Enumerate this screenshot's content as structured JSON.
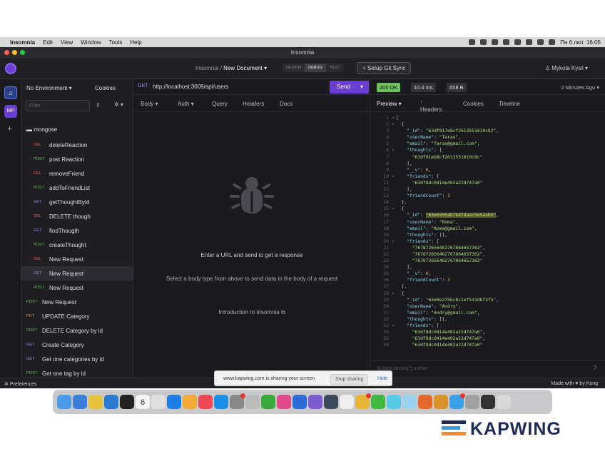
{
  "menubar": {
    "app": "Insomnia",
    "items": [
      "Edit",
      "View",
      "Window",
      "Tools",
      "Help"
    ],
    "clock": "Пн 6 лют.  16:05"
  },
  "window": {
    "title": "Insomnia"
  },
  "toolbar": {
    "breadcrumb_root": "Insomnia",
    "separator": "/",
    "document": "New Document ▾",
    "modes": [
      "DESIGN",
      "DEBUG",
      "TEST"
    ],
    "active_mode": "DEBUG",
    "git_button": "Setup Git Sync",
    "user": "Mykola Kysil ▾"
  },
  "rail": {
    "home_icon": "home-icon",
    "workspace": "MP",
    "add": "+"
  },
  "sidebar": {
    "environment": "No Environment ▾",
    "cookies": "Cookies",
    "filter_placeholder": "Filter",
    "folder": "mongose",
    "items": [
      {
        "method": "DEL",
        "name": "deleteReaction",
        "indent": true
      },
      {
        "method": "POST",
        "name": "post Reaction",
        "indent": true
      },
      {
        "method": "DEL",
        "name": "removeFriend",
        "indent": true
      },
      {
        "method": "POST",
        "name": "addToFriendList",
        "indent": true
      },
      {
        "method": "GET",
        "name": "getThoughtById",
        "indent": true
      },
      {
        "method": "DEL",
        "name": "DELETE though",
        "indent": true
      },
      {
        "method": "GET",
        "name": "findThougth",
        "indent": true
      },
      {
        "method": "POST",
        "name": "createThought",
        "indent": true
      },
      {
        "method": "DEL",
        "name": "New Request",
        "indent": true
      },
      {
        "method": "GET",
        "name": "New Request",
        "indent": true,
        "selected": true
      },
      {
        "method": "POST",
        "name": "New Request",
        "indent": true
      },
      {
        "method": "POST",
        "name": "New Request",
        "indent": false
      },
      {
        "method": "PUT",
        "name": "UPDATE Category",
        "indent": false
      },
      {
        "method": "POST",
        "name": "DELETE Category by id",
        "indent": false
      },
      {
        "method": "GET",
        "name": "Create Category",
        "indent": false
      },
      {
        "method": "GET",
        "name": "Get one categories by id",
        "indent": false
      },
      {
        "method": "POST",
        "name": "Get one tag by id",
        "indent": false
      }
    ]
  },
  "request": {
    "method": "GET",
    "url": "http://localhost:3009/api/users",
    "send": "Send",
    "tabs": [
      "Body ▾",
      "Auth ▾",
      "Query",
      "Headers",
      "Docs"
    ],
    "empty_title": "Enter a URL and send to get a response",
    "empty_hint": "Select a body type from above to send data in the body of a request",
    "intro_link": "Introduction to Insomnia"
  },
  "response": {
    "status": "200 OK",
    "time": "10.4 ms",
    "size": "658 B",
    "age": "2 Minutes Ago ▾",
    "tabs": [
      "Preview ▾",
      "Headers",
      "Cookies",
      "Timeline"
    ],
    "headers_count": "7",
    "filter": "$.store.books[*].author",
    "help": "?"
  },
  "json_lines": [
    {
      "n": "1",
      "a": "▾",
      "t": [
        [
          "p",
          "["
        ]
      ]
    },
    {
      "n": "2",
      "a": "▾",
      "t": [
        [
          "p",
          "  {"
        ]
      ]
    },
    {
      "n": "3",
      "a": "",
      "t": [
        [
          "k",
          "    \"_id\""
        ],
        [
          "p",
          ": "
        ],
        [
          "s",
          "\"63df917e8cf2613551610c82\""
        ],
        [
          "p",
          ","
        ]
      ]
    },
    {
      "n": "4",
      "a": "",
      "t": [
        [
          "k",
          "    \"userName\""
        ],
        [
          "p",
          ": "
        ],
        [
          "s",
          "\"Taras\""
        ],
        [
          "p",
          ","
        ]
      ]
    },
    {
      "n": "5",
      "a": "",
      "t": [
        [
          "k",
          "    \"email\""
        ],
        [
          "p",
          ": "
        ],
        [
          "s",
          "\"Taras@gmail.com\""
        ],
        [
          "p",
          ","
        ]
      ]
    },
    {
      "n": "6",
      "a": "▾",
      "t": [
        [
          "k",
          "    \"thoughts\""
        ],
        [
          "p",
          ": ["
        ]
      ]
    },
    {
      "n": "7",
      "a": "",
      "t": [
        [
          "s",
          "      \"63df91eb8cf2613551610c8c\""
        ]
      ]
    },
    {
      "n": "8",
      "a": "",
      "t": [
        [
          "p",
          "    ],"
        ]
      ]
    },
    {
      "n": "9",
      "a": "",
      "t": [
        [
          "k",
          "    \"__v\""
        ],
        [
          "p",
          ": "
        ],
        [
          "n",
          "0"
        ],
        [
          "p",
          ","
        ]
      ]
    },
    {
      "n": "10",
      "a": "▾",
      "t": [
        [
          "k",
          "    \"friends\""
        ],
        [
          "p",
          ": ["
        ]
      ]
    },
    {
      "n": "11",
      "a": "",
      "t": [
        [
          "s",
          "      \"63df8dc0414e402a22d747a0\""
        ]
      ]
    },
    {
      "n": "12",
      "a": "",
      "t": [
        [
          "p",
          "    ],"
        ]
      ]
    },
    {
      "n": "13",
      "a": "",
      "t": [
        [
          "k",
          "    \"friendCount\""
        ],
        [
          "p",
          ": "
        ],
        [
          "n",
          "1"
        ]
      ]
    },
    {
      "n": "14",
      "a": "",
      "t": [
        [
          "p",
          "  },"
        ]
      ]
    },
    {
      "n": "15",
      "a": "▾",
      "t": [
        [
          "p",
          "  {"
        ]
      ]
    },
    {
      "n": "16",
      "a": "",
      "t": [
        [
          "k",
          "    \"_id\""
        ],
        [
          "p",
          ": "
        ],
        [
          "hl",
          "\"63e0255ab7b4fdaac5e5aab5\""
        ],
        [
          "p",
          ","
        ]
      ]
    },
    {
      "n": "17",
      "a": "",
      "t": [
        [
          "k",
          "    \"userName\""
        ],
        [
          "p",
          ": "
        ],
        [
          "s",
          "\"Roma\""
        ],
        [
          "p",
          ","
        ]
      ]
    },
    {
      "n": "18",
      "a": "",
      "t": [
        [
          "k",
          "    \"email\""
        ],
        [
          "p",
          ": "
        ],
        [
          "s",
          "\"Roma@gmail.com\""
        ],
        [
          "p",
          ","
        ]
      ]
    },
    {
      "n": "19",
      "a": "",
      "t": [
        [
          "k",
          "    \"thoughts\""
        ],
        [
          "p",
          ": [],"
        ]
      ]
    },
    {
      "n": "20",
      "a": "▾",
      "t": [
        [
          "k",
          "    \"friends\""
        ],
        [
          "p",
          ": ["
        ]
      ]
    },
    {
      "n": "21",
      "a": "",
      "t": [
        [
          "s",
          "      \"767872656462767864657362\""
        ],
        [
          "p",
          ","
        ]
      ]
    },
    {
      "n": "22",
      "a": "",
      "t": [
        [
          "s",
          "      \"767872656462767864657362\""
        ],
        [
          "p",
          ","
        ]
      ]
    },
    {
      "n": "23",
      "a": "",
      "t": [
        [
          "s",
          "      \"767872656462767864657362\""
        ]
      ]
    },
    {
      "n": "24",
      "a": "",
      "t": [
        [
          "p",
          "    ],"
        ]
      ]
    },
    {
      "n": "25",
      "a": "",
      "t": [
        [
          "k",
          "    \"__v\""
        ],
        [
          "p",
          ": "
        ],
        [
          "n",
          "0"
        ],
        [
          "p",
          ","
        ]
      ]
    },
    {
      "n": "26",
      "a": "",
      "t": [
        [
          "k",
          "    \"friendCount\""
        ],
        [
          "p",
          ": "
        ],
        [
          "n",
          "3"
        ]
      ]
    },
    {
      "n": "27",
      "a": "",
      "t": [
        [
          "p",
          "  },"
        ]
      ]
    },
    {
      "n": "28",
      "a": "▾",
      "t": [
        [
          "p",
          "  {"
        ]
      ]
    },
    {
      "n": "29",
      "a": "",
      "t": [
        [
          "k",
          "    \"_id\""
        ],
        [
          "p",
          ": "
        ],
        [
          "s",
          "\"63e0e275bc8c1ef531dbf3f5\""
        ],
        [
          "p",
          ","
        ]
      ]
    },
    {
      "n": "30",
      "a": "",
      "t": [
        [
          "k",
          "    \"userName\""
        ],
        [
          "p",
          ": "
        ],
        [
          "s",
          "\"Andry\""
        ],
        [
          "p",
          ","
        ]
      ]
    },
    {
      "n": "31",
      "a": "",
      "t": [
        [
          "k",
          "    \"email\""
        ],
        [
          "p",
          ": "
        ],
        [
          "s",
          "\"Andry@gmail.com\""
        ],
        [
          "p",
          ","
        ]
      ]
    },
    {
      "n": "32",
      "a": "",
      "t": [
        [
          "k",
          "    \"thoughts\""
        ],
        [
          "p",
          ": [],"
        ]
      ]
    },
    {
      "n": "33",
      "a": "▾",
      "t": [
        [
          "k",
          "    \"friends\""
        ],
        [
          "p",
          ": ["
        ]
      ]
    },
    {
      "n": "34",
      "a": "",
      "t": [
        [
          "s",
          "      \"63df8dc0414e402a22d747a0\""
        ],
        [
          "p",
          ","
        ]
      ]
    },
    {
      "n": "35",
      "a": "",
      "t": [
        [
          "s",
          "      \"63df8dc0414e402a22d747a0\""
        ],
        [
          "p",
          ","
        ]
      ]
    },
    {
      "n": "36",
      "a": "",
      "t": [
        [
          "s",
          "      \"63df8dc0414e402a22d747a0\""
        ]
      ]
    }
  ],
  "statusbar": {
    "preferences": "Preferences",
    "made_with": "Made with ♥ by Kong"
  },
  "share": {
    "text": "www.kapwing.com is sharing your screen.",
    "stop": "Stop sharing",
    "hide": "Hide"
  },
  "dock": {
    "calendar_day": "6"
  },
  "watermark": {
    "text": "KAPWING"
  },
  "colors": {
    "accent": "#6b3fd4",
    "ok": "#6dc25b",
    "get": "#9a8bf0",
    "post": "#6dc25b",
    "del": "#e0644a",
    "put": "#e09440"
  }
}
